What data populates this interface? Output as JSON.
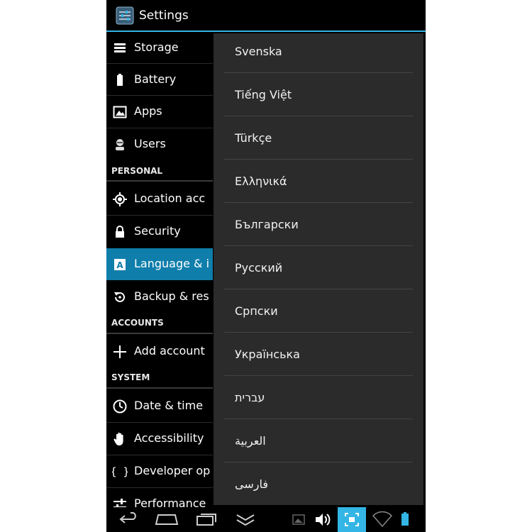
{
  "actionbar": {
    "title": "Settings",
    "icon": "settings-app-icon"
  },
  "sidebar": {
    "items": [
      {
        "label": "Storage",
        "icon": "storage-icon"
      },
      {
        "label": "Battery",
        "icon": "battery-icon"
      },
      {
        "label": "Apps",
        "icon": "apps-icon"
      },
      {
        "label": "Users",
        "icon": "users-icon"
      },
      {
        "label": "Location acc",
        "icon": "location-icon"
      },
      {
        "label": "Security",
        "icon": "lock-icon"
      },
      {
        "label": "Language & i",
        "icon": "language-icon",
        "selected": true
      },
      {
        "label": "Backup & res",
        "icon": "backup-icon"
      },
      {
        "label": "Add account",
        "icon": "plus-icon"
      },
      {
        "label": "Date & time",
        "icon": "clock-icon"
      },
      {
        "label": "Accessibility",
        "icon": "hand-icon"
      },
      {
        "label": "Developer op",
        "icon": "braces-icon"
      },
      {
        "label": "Performance",
        "icon": "sliders-icon"
      }
    ],
    "headers": {
      "personal": "PERSONAL",
      "accounts": "ACCOUNTS",
      "system": "SYSTEM"
    }
  },
  "language_dialog": {
    "options": [
      "Svenska",
      "Tiếng Việt",
      "Türkçe",
      "Ελληνικά",
      "Български",
      "Русский",
      "Српски",
      "Українська",
      "עברית",
      "العربية",
      "فارسی"
    ]
  },
  "navbar": {
    "buttons": [
      "back-icon",
      "home-icon",
      "recent-apps-icon",
      "collapse-icon",
      "screenshot-icon",
      "volume-icon",
      "fullscreen-icon",
      "wifi-icon",
      "battery-status-icon"
    ]
  },
  "colors": {
    "accent": "#33b5e5",
    "selected": "#0f7eab",
    "dialog_bg": "#2b2b2b"
  }
}
